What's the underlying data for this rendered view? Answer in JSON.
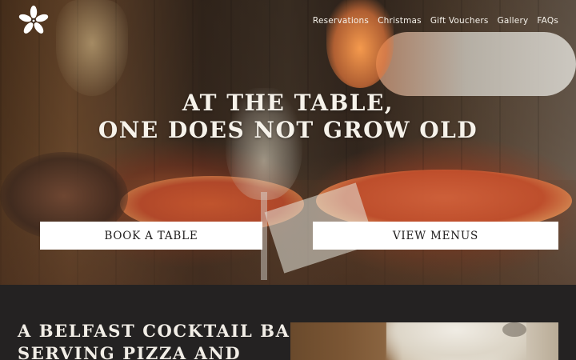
{
  "brand": {
    "logo_icon": "asterisk-flower-logo-icon"
  },
  "nav": {
    "items": [
      {
        "label": "Reservations"
      },
      {
        "label": "Christmas"
      },
      {
        "label": "Gift Vouchers"
      },
      {
        "label": "Gallery"
      },
      {
        "label": "FAQs"
      }
    ]
  },
  "hero": {
    "headline_line1": "AT THE TABLE,",
    "headline_line2": "ONE DOES NOT GROW OLD",
    "book_label": "BOOK A TABLE",
    "menus_label": "VIEW MENUS"
  },
  "about": {
    "tagline_line1": "A BELFAST COCKTAIL BAR",
    "tagline_line2": "SERVING PIZZA AND"
  },
  "colors": {
    "background_dark": "#242222",
    "text_light": "#f6f2ea",
    "button_bg": "#ffffff",
    "button_text": "#1d1b1b"
  }
}
